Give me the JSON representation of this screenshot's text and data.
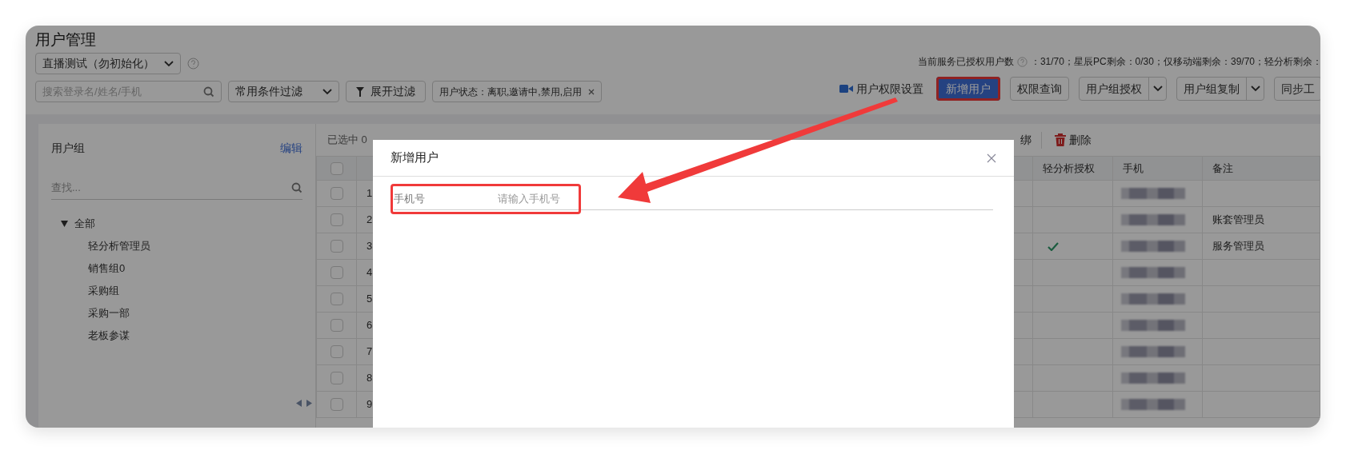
{
  "page": {
    "title": "用户管理",
    "account_select": "直播测试（勿初始化）",
    "search_placeholder": "搜索登录名/姓名/手机",
    "filter_select": "常用条件过滤",
    "expand_filter": "展开过滤",
    "filter_tag": "用户状态：离职,邀请中,禁用,启用"
  },
  "license": {
    "label": "当前服务已授权用户数",
    "counts": "：31/70；星辰PC剩余：0/30；仅移动端剩余：39/70；轻分析剩余："
  },
  "toolbar": [
    {
      "label": "用户权限设置",
      "kind": "link",
      "annotated": false
    },
    {
      "label": "新增用户",
      "kind": "primary",
      "annotated": true
    },
    {
      "label": "权限查询",
      "kind": "plain",
      "annotated": false
    },
    {
      "label": "用户组授权",
      "kind": "split",
      "annotated": false
    },
    {
      "label": "用户组复制",
      "kind": "split",
      "annotated": false
    },
    {
      "label": "同步工",
      "kind": "plain",
      "annotated": false
    }
  ],
  "sidebar": {
    "title": "用户组",
    "edit": "编辑",
    "search_placeholder": "查找...",
    "tree": [
      {
        "label": "全部",
        "expanded": true,
        "children": [
          {
            "label": "轻分析管理员"
          },
          {
            "label": "销售组0"
          },
          {
            "label": "采购组"
          },
          {
            "label": "采购一部"
          },
          {
            "label": "老板参谋"
          }
        ]
      }
    ]
  },
  "table_toolbar": {
    "selection": "已选中 0",
    "items": [
      {
        "label": "绑",
        "kind": "plain"
      },
      {
        "label": "删除",
        "kind": "delete"
      }
    ]
  },
  "table": {
    "header_checked": false,
    "columns": [
      "轻分析授权",
      "手机",
      "备注"
    ],
    "rows": [
      {
        "index": "1",
        "checked": false,
        "analysis": false,
        "note": ""
      },
      {
        "index": "2",
        "checked": false,
        "analysis": false,
        "note": "账套管理员"
      },
      {
        "index": "3",
        "checked": false,
        "analysis": true,
        "note": "服务管理员"
      },
      {
        "index": "4",
        "checked": false,
        "analysis": false,
        "note": ""
      },
      {
        "index": "5",
        "checked": false,
        "analysis": false,
        "note": ""
      },
      {
        "index": "6",
        "checked": false,
        "analysis": false,
        "note": ""
      },
      {
        "index": "7",
        "checked": false,
        "analysis": false,
        "note": ""
      },
      {
        "index": "8",
        "checked": false,
        "analysis": false,
        "note": ""
      },
      {
        "index": "9",
        "checked": false,
        "analysis": false,
        "note": ""
      }
    ]
  },
  "modal": {
    "title": "新增用户",
    "fields": [
      {
        "label": "手机号",
        "placeholder": "请输入手机号",
        "annotated": true
      }
    ]
  }
}
